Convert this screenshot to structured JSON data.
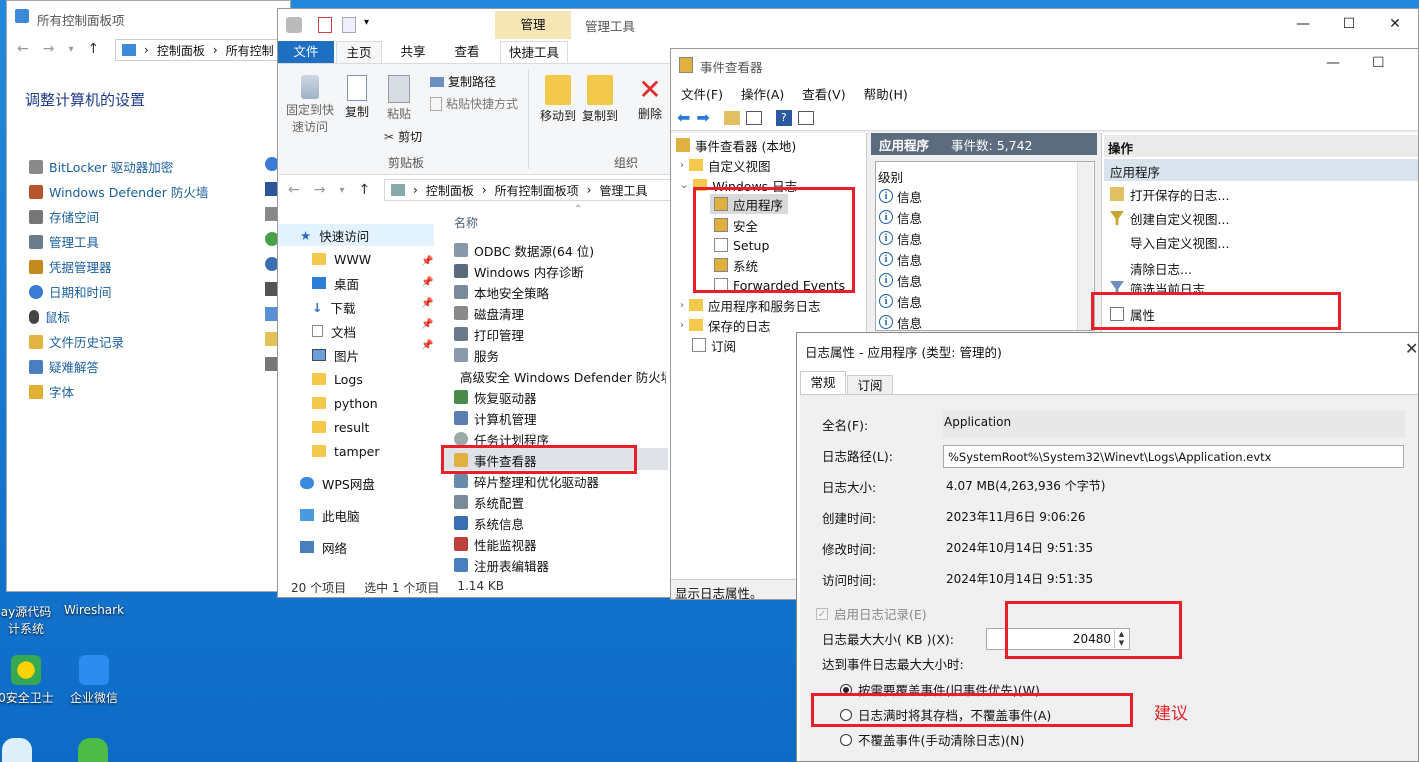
{
  "desktop": {
    "icons": [
      {
        "label": "ay源代码\n计系统",
        "icon": "app-icon"
      },
      {
        "label": "Wireshark",
        "icon": "wireshark-icon"
      },
      {
        "label": "0安全卫士",
        "icon": "360-icon"
      },
      {
        "label": "企业微信",
        "icon": "wecom-icon"
      }
    ]
  },
  "control_panel": {
    "window_title": "所有控制面板项",
    "breadcrumb": [
      "控制面板",
      "所有控制"
    ],
    "heading": "调整计算机的设置",
    "items": [
      "BitLocker 驱动器加密",
      "Windows Defender 防火墙",
      "存储空间",
      "管理工具",
      "凭据管理器",
      "日期和时间",
      "鼠标",
      "文件历史记录",
      "疑难解答",
      "字体"
    ]
  },
  "explorer": {
    "context_tab": "管理",
    "window_title": "管理工具",
    "tabs": {
      "file": "文件",
      "home": "主页",
      "share": "共享",
      "view": "查看",
      "tools": "快捷工具"
    },
    "ribbon": {
      "pin": "固定到快\n速访问",
      "copy": "复制",
      "paste": "粘贴",
      "copy_path": "复制路径",
      "paste_shortcut": "粘贴快捷方式",
      "cut": "剪切",
      "clipboard_group": "剪贴板",
      "move_to": "移动到",
      "copy_to": "复制到",
      "delete": "删除",
      "organize_group": "组织"
    },
    "address": [
      "控制面板",
      "所有控制面板项",
      "管理工具"
    ],
    "column_name": "名称",
    "nav": [
      "快速访问",
      "WWW",
      "桌面",
      "下载",
      "文档",
      "图片",
      "Logs",
      "python",
      "result",
      "tamper",
      "WPS网盘",
      "此电脑",
      "网络"
    ],
    "files": [
      "ODBC 数据源(64 位)",
      "Windows 内存诊断",
      "本地安全策略",
      "磁盘清理",
      "打印管理",
      "服务",
      "高级安全 Windows Defender 防火墙",
      "恢复驱动器",
      "计算机管理",
      "任务计划程序",
      "事件查看器",
      "碎片整理和优化驱动器",
      "系统配置",
      "系统信息",
      "性能监视器",
      "注册表编辑器"
    ],
    "status": {
      "count": "20 个项目",
      "selected": "选中 1 个项目",
      "size": "1.14 KB"
    }
  },
  "event_viewer": {
    "window_title": "事件查看器",
    "menu": [
      "文件(F)",
      "操作(A)",
      "查看(V)",
      "帮助(H)"
    ],
    "tree": {
      "root": "事件查看器 (本地)",
      "custom": "自定义视图",
      "windows_logs": "Windows 日志",
      "app": "应用程序",
      "security": "安全",
      "setup": "Setup",
      "system": "系统",
      "forwarded": "Forwarded Events",
      "app_service": "应用程序和服务日志",
      "saved": "保存的日志",
      "subscriptions": "订阅"
    },
    "mid_header": {
      "name": "应用程序",
      "count": "事件数: 5,742"
    },
    "level_col": "级别",
    "levels": [
      "信息",
      "信息",
      "信息",
      "信息",
      "信息",
      "信息",
      "信息"
    ],
    "actions": {
      "header": "操作",
      "section": "应用程序",
      "items": [
        "打开保存的日志...",
        "创建自定义视图...",
        "导入自定义视图...",
        "清除日志...",
        "筛选当前日志...",
        "属性"
      ]
    },
    "status": "显示日志属性。"
  },
  "props_dialog": {
    "title": "日志属性 - 应用程序 (类型: 管理的)",
    "tabs": [
      "常规",
      "订阅"
    ],
    "full_name_label": "全名(F):",
    "full_name": "Application",
    "log_path_label": "日志路径(L):",
    "log_path": "%SystemRoot%\\System32\\Winevt\\Logs\\Application.evtx",
    "log_size_label": "日志大小:",
    "log_size": "4.07 MB(4,263,936 个字节)",
    "created_label": "创建时间:",
    "created": "2023年11月6日 9:06:26",
    "modified_label": "修改时间:",
    "modified": "2024年10月14日 9:51:35",
    "accessed_label": "访问时间:",
    "accessed": "2024年10月14日 9:51:35",
    "enable_logging": "启用日志记录(E)",
    "max_size_label": "日志最大大小( KB )(X):",
    "max_size": "20480",
    "when_max_label": "达到事件日志最大大小时:",
    "options": [
      "按需要覆盖事件(旧事件优先)(W)",
      "日志满时将其存档，不覆盖事件(A)",
      "不覆盖事件(手动清除日志)(N)"
    ],
    "selected_option": 0
  },
  "annotation": {
    "suggest": "建议"
  },
  "colors": {
    "accent": "#1a5e9e",
    "red": "#e8202a",
    "ribbon_file": "#1e6fc2"
  }
}
